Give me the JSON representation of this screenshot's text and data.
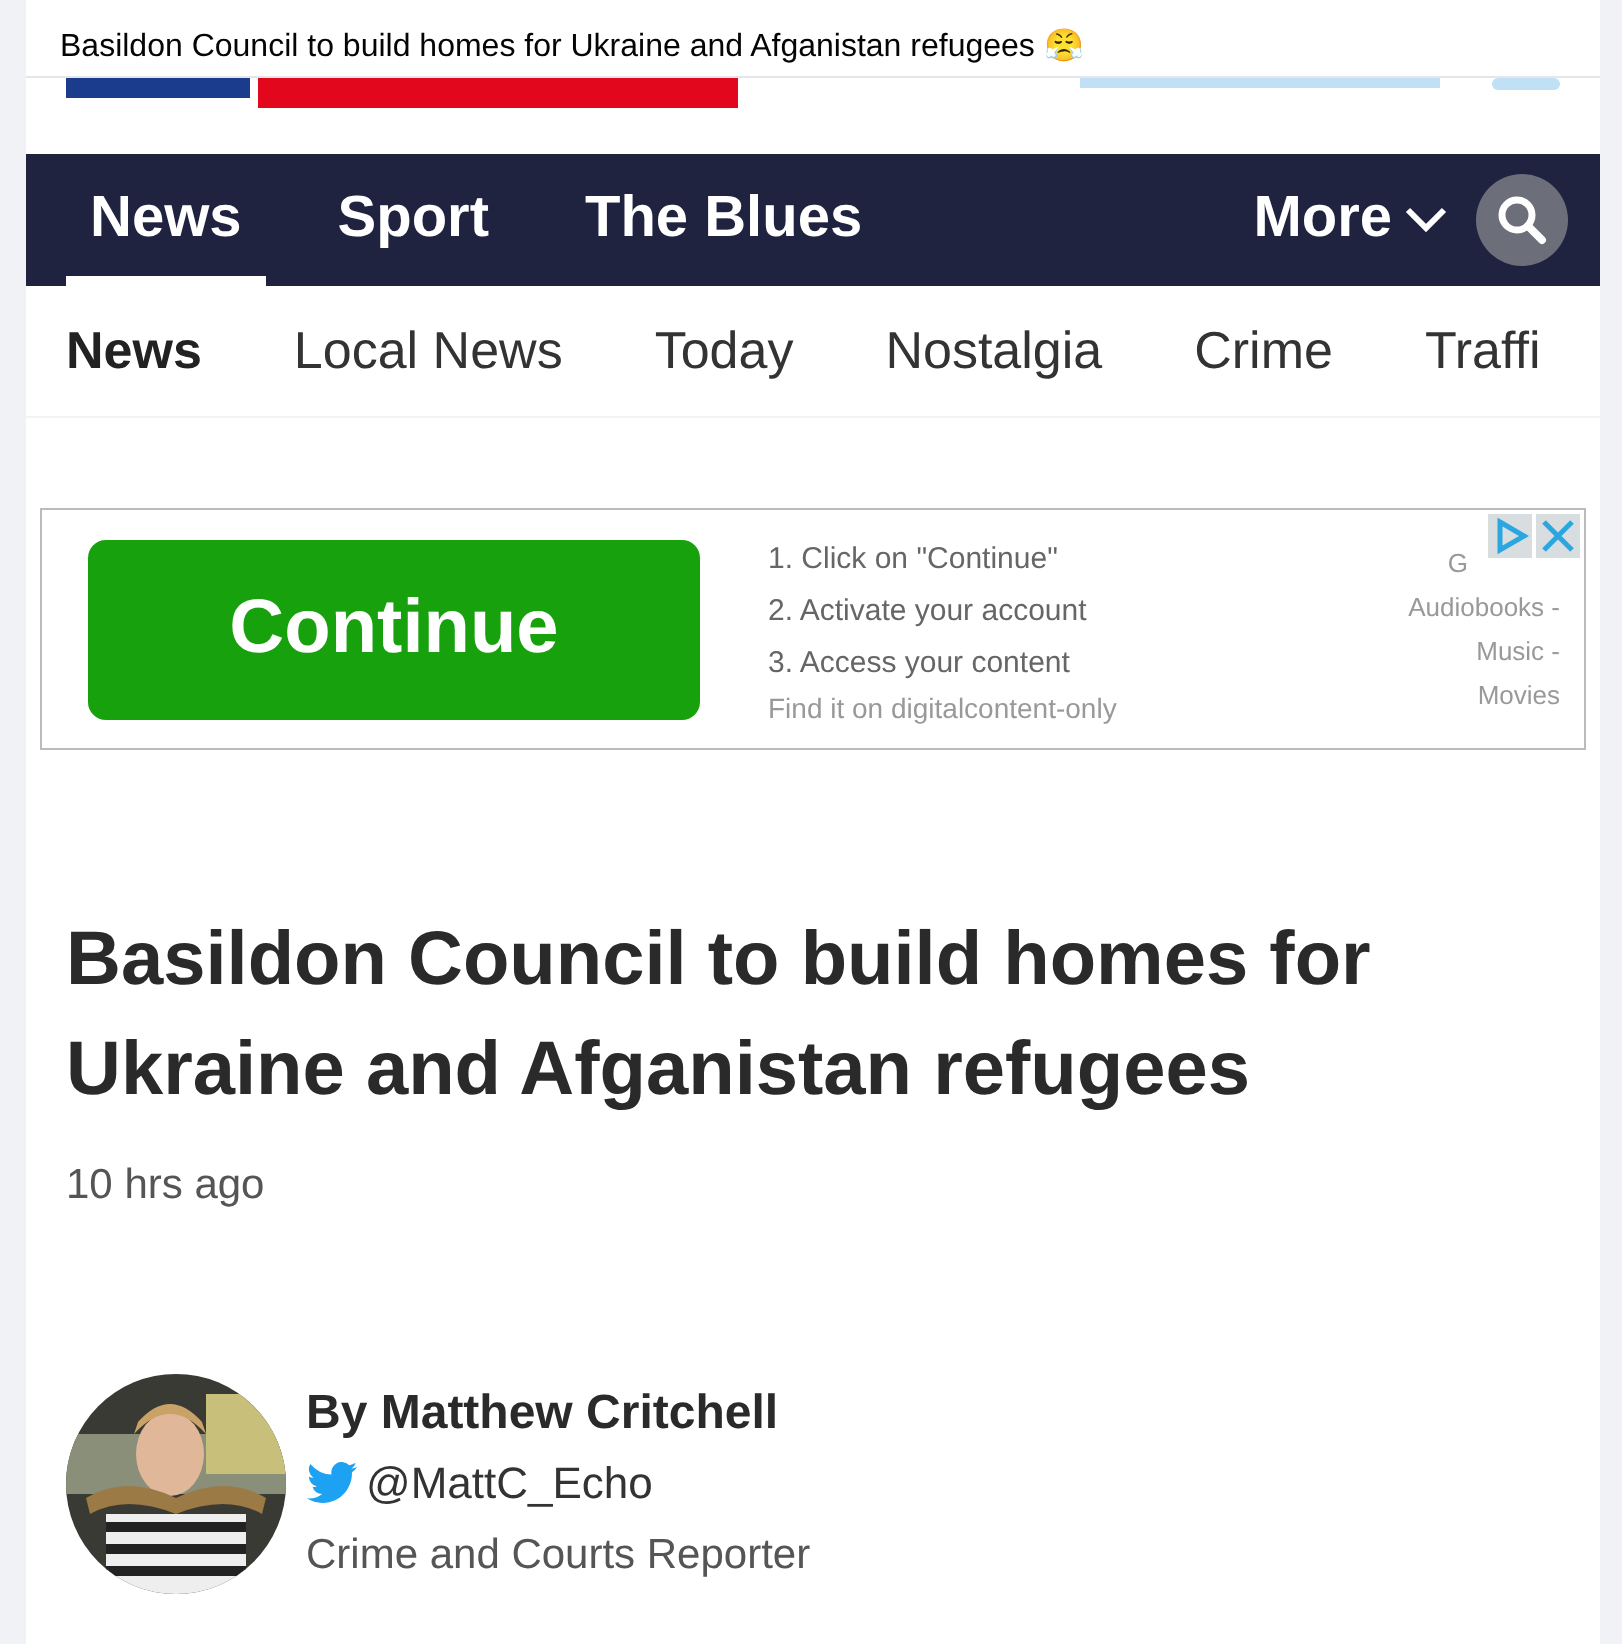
{
  "post": {
    "text": "Basildon Council to build homes for Ukraine and Afganistan refugees 😤"
  },
  "nav": {
    "items": [
      {
        "label": "News",
        "selected": true
      },
      {
        "label": "Sport",
        "selected": false
      },
      {
        "label": "The Blues",
        "selected": false
      }
    ],
    "more": "More"
  },
  "subnav": [
    {
      "label": "News",
      "selected": true
    },
    {
      "label": "Local News",
      "selected": false
    },
    {
      "label": "Today",
      "selected": false
    },
    {
      "label": "Nostalgia",
      "selected": false
    },
    {
      "label": "Crime",
      "selected": false
    },
    {
      "label": "Traffi",
      "selected": false
    }
  ],
  "ad": {
    "button": "Continue",
    "steps": [
      "1. Click on \"Continue\"",
      "2. Activate your account",
      "3. Access your content"
    ],
    "note": "Find it on digitalcontent-only",
    "side": [
      "G",
      "Audiobooks -",
      "Music -",
      "Movies"
    ]
  },
  "article": {
    "headline": "Basildon Council to build homes for Ukraine and Afganistan refugees",
    "time": "10 hrs ago"
  },
  "author": {
    "name": "By Matthew Critchell",
    "handle": "@MattC_Echo",
    "role": "Crime and Courts Reporter"
  }
}
